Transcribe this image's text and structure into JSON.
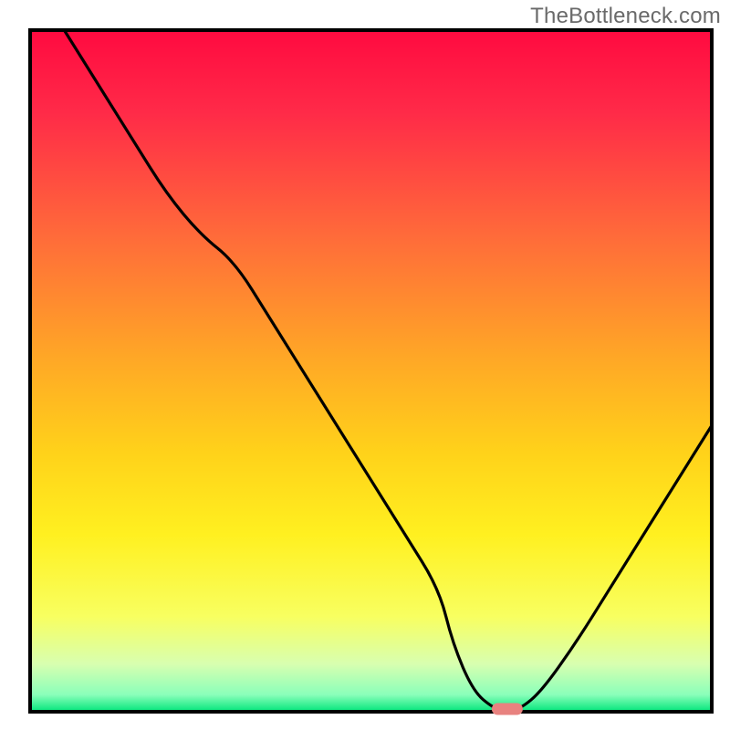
{
  "watermark": "TheBottleneck.com",
  "chart_data": {
    "type": "line",
    "title": "",
    "xlabel": "",
    "ylabel": "",
    "xlim": [
      0,
      100
    ],
    "ylim": [
      0,
      100
    ],
    "grid": false,
    "legend": false,
    "series": [
      {
        "name": "bottleneck-curve",
        "color": "#000000",
        "x": [
          5,
          10,
          15,
          20,
          25,
          30,
          35,
          40,
          45,
          50,
          55,
          60,
          62,
          65,
          68,
          70,
          72,
          75,
          80,
          85,
          90,
          95,
          100
        ],
        "y": [
          100,
          92,
          84,
          76,
          70,
          66,
          58,
          50,
          42,
          34,
          26,
          18,
          10,
          3,
          0.5,
          0,
          0.5,
          3,
          10,
          18,
          26,
          34,
          42
        ]
      }
    ],
    "marker": {
      "name": "optimal-point",
      "x": 70,
      "y": 0,
      "color": "#e8827f",
      "shape": "capsule"
    },
    "background_gradient": {
      "type": "vertical",
      "stops": [
        {
          "offset": 0.0,
          "color": "#ff0a40"
        },
        {
          "offset": 0.12,
          "color": "#ff2a48"
        },
        {
          "offset": 0.3,
          "color": "#ff6a3a"
        },
        {
          "offset": 0.48,
          "color": "#ffa726"
        },
        {
          "offset": 0.62,
          "color": "#ffd21a"
        },
        {
          "offset": 0.74,
          "color": "#fff020"
        },
        {
          "offset": 0.86,
          "color": "#f8ff60"
        },
        {
          "offset": 0.93,
          "color": "#d8ffb0"
        },
        {
          "offset": 0.975,
          "color": "#8affba"
        },
        {
          "offset": 1.0,
          "color": "#00e57a"
        }
      ]
    },
    "frame": {
      "stroke": "#000000",
      "width": 4
    }
  }
}
